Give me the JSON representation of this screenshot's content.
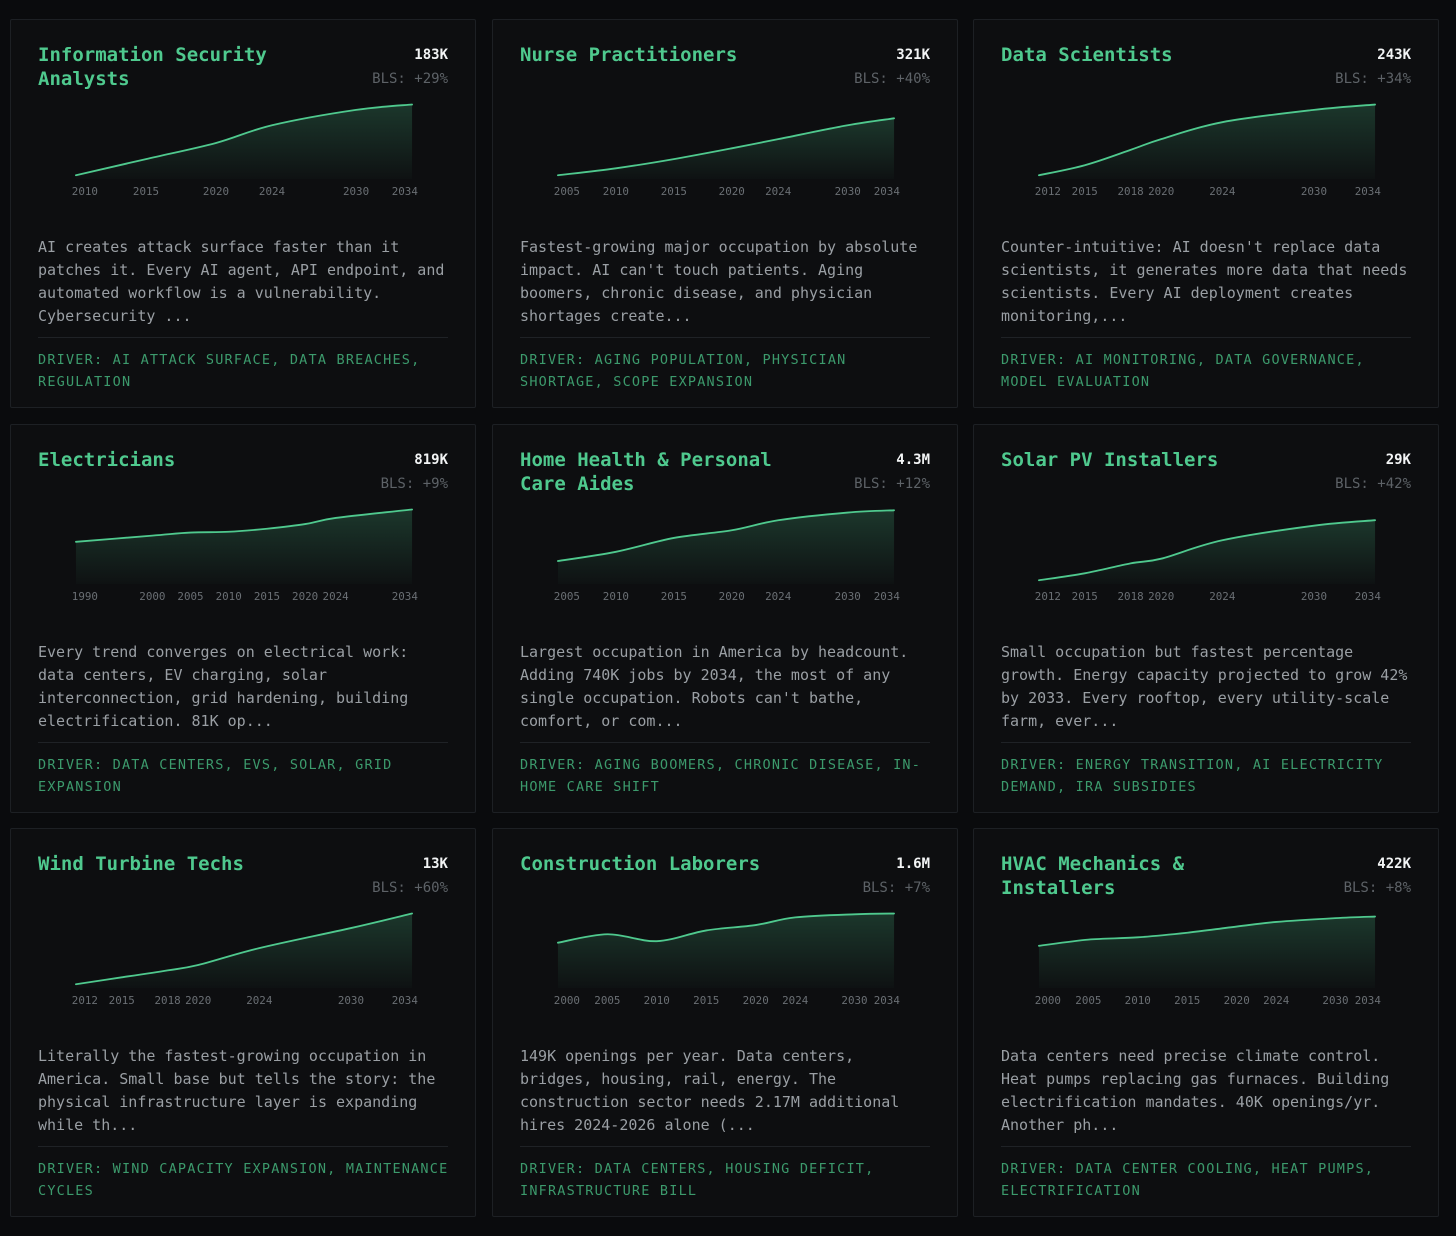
{
  "accent_color": "#4fc98e",
  "cards": [
    {
      "title": "Information Security\nAnalysts",
      "count": "183K",
      "bls": "BLS: +29%",
      "description": "AI creates attack surface faster than it patches it. Every AI agent, API endpoint, and automated workflow is a vulnerability. Cybersecurity ...",
      "driver": "DRIVER: AI ATTACK SURFACE, DATA BREACHES, REGULATION",
      "chart_data": {
        "type": "area",
        "x": [
          2010,
          2015,
          2020,
          2024,
          2030,
          2034
        ],
        "y": [
          0.05,
          0.26,
          0.47,
          0.7,
          0.9,
          0.97
        ],
        "tick_labels": [
          "2010",
          "2015",
          "2020",
          "2024",
          "2030",
          "2034"
        ]
      }
    },
    {
      "title": "Nurse Practitioners",
      "count": "321K",
      "bls": "BLS: +40%",
      "description": "Fastest-growing major occupation by absolute impact. AI can't touch patients. Aging boomers, chronic disease, and physician shortages create...",
      "driver": "DRIVER: AGING POPULATION, PHYSICIAN SHORTAGE, SCOPE EXPANSION",
      "chart_data": {
        "type": "area",
        "x": [
          2005,
          2010,
          2015,
          2020,
          2024,
          2030,
          2034
        ],
        "y": [
          0.05,
          0.14,
          0.26,
          0.4,
          0.52,
          0.7,
          0.79
        ],
        "tick_labels": [
          "2005",
          "2010",
          "2015",
          "2020",
          "2024",
          "2030",
          "2034"
        ]
      }
    },
    {
      "title": "Data Scientists",
      "count": "243K",
      "bls": "BLS: +34%",
      "description": "Counter-intuitive: AI doesn't replace data scientists, it generates more data that needs scientists. Every AI deployment creates monitoring,...",
      "driver": "DRIVER: AI MONITORING, DATA GOVERNANCE, MODEL EVALUATION",
      "chart_data": {
        "type": "area",
        "x": [
          2012,
          2015,
          2018,
          2020,
          2024,
          2030,
          2034
        ],
        "y": [
          0.05,
          0.18,
          0.38,
          0.52,
          0.74,
          0.9,
          0.97
        ],
        "tick_labels": [
          "2012",
          "2015",
          "2018",
          "2020",
          "2024",
          "2030",
          "2034"
        ]
      }
    },
    {
      "title": "Electricians",
      "count": "819K",
      "bls": "BLS: +9%",
      "description": "Every trend converges on electrical work: data centers, EV charging, solar interconnection, grid hardening, building electrification. 81K op...",
      "driver": "DRIVER: DATA CENTERS, EVS, SOLAR, GRID EXPANSION",
      "chart_data": {
        "type": "area",
        "x": [
          1990,
          2000,
          2005,
          2010,
          2015,
          2020,
          2024,
          2034
        ],
        "y": [
          0.55,
          0.63,
          0.67,
          0.68,
          0.72,
          0.78,
          0.86,
          0.97
        ],
        "tick_labels": [
          "1990",
          "2000",
          "2005",
          "2010",
          "2015",
          "2020",
          "2024",
          "2034"
        ]
      }
    },
    {
      "title": "Home Health & Personal\nCare Aides",
      "count": "4.3M",
      "bls": "BLS: +12%",
      "description": "Largest occupation in America by headcount. Adding 740K jobs by 2034, the most of any single occupation. Robots can't bathe, comfort, or com...",
      "driver": "DRIVER: AGING BOOMERS, CHRONIC DISEASE, IN-HOME CARE SHIFT",
      "chart_data": {
        "type": "area",
        "x": [
          2005,
          2010,
          2015,
          2020,
          2024,
          2030,
          2034
        ],
        "y": [
          0.3,
          0.42,
          0.6,
          0.7,
          0.83,
          0.93,
          0.96
        ],
        "tick_labels": [
          "2005",
          "2010",
          "2015",
          "2020",
          "2024",
          "2030",
          "2034"
        ]
      }
    },
    {
      "title": "Solar PV Installers",
      "count": "29K",
      "bls": "BLS: +42%",
      "description": "Small occupation but fastest percentage growth. Energy capacity projected to grow 42% by 2033. Every rooftop, every utility-scale farm, ever...",
      "driver": "DRIVER: ENERGY TRANSITION, AI ELECTRICITY DEMAND, IRA SUBSIDIES",
      "chart_data": {
        "type": "area",
        "x": [
          2012,
          2015,
          2018,
          2020,
          2024,
          2030,
          2034
        ],
        "y": [
          0.05,
          0.14,
          0.27,
          0.33,
          0.57,
          0.76,
          0.83
        ],
        "tick_labels": [
          "2012",
          "2015",
          "2018",
          "2020",
          "2024",
          "2030",
          "2034"
        ]
      }
    },
    {
      "title": "Wind Turbine Techs",
      "count": "13K",
      "bls": "BLS: +60%",
      "description": "Literally the fastest-growing occupation in America. Small base but tells the story: the physical infrastructure layer is expanding while th...",
      "driver": "DRIVER: WIND CAPACITY EXPANSION, MAINTENANCE CYCLES",
      "chart_data": {
        "type": "area",
        "x": [
          2012,
          2015,
          2018,
          2020,
          2024,
          2030,
          2034
        ],
        "y": [
          0.05,
          0.14,
          0.23,
          0.3,
          0.52,
          0.78,
          0.97
        ],
        "tick_labels": [
          "2012",
          "2015",
          "2018",
          "2020",
          "2024",
          "2030",
          "2034"
        ]
      }
    },
    {
      "title": "Construction Laborers",
      "count": "1.6M",
      "bls": "BLS: +7%",
      "description": "149K openings per year. Data centers, bridges, housing, rail, energy. The construction sector needs 2.17M additional hires 2024-2026 alone (...",
      "driver": "DRIVER: DATA CENTERS, HOUSING DEFICIT, INFRASTRUCTURE BILL",
      "chart_data": {
        "type": "area",
        "x": [
          2000,
          2005,
          2010,
          2015,
          2020,
          2024,
          2030,
          2034
        ],
        "y": [
          0.59,
          0.7,
          0.61,
          0.75,
          0.82,
          0.92,
          0.96,
          0.97
        ],
        "tick_labels": [
          "2000",
          "2005",
          "2010",
          "2015",
          "2020",
          "2024",
          "2030",
          "2034"
        ]
      }
    },
    {
      "title": "HVAC Mechanics &\nInstallers",
      "count": "422K",
      "bls": "BLS: +8%",
      "description": "Data centers need precise climate control. Heat pumps replacing gas furnaces. Building electrification mandates. 40K openings/yr. Another ph...",
      "driver": "DRIVER: DATA CENTER COOLING, HEAT PUMPS, ELECTRIFICATION",
      "chart_data": {
        "type": "area",
        "x": [
          2000,
          2005,
          2010,
          2015,
          2020,
          2024,
          2030,
          2034
        ],
        "y": [
          0.55,
          0.63,
          0.66,
          0.72,
          0.8,
          0.86,
          0.91,
          0.93
        ],
        "tick_labels": [
          "2000",
          "2005",
          "2010",
          "2015",
          "2020",
          "2024",
          "2030",
          "2034"
        ]
      }
    }
  ]
}
